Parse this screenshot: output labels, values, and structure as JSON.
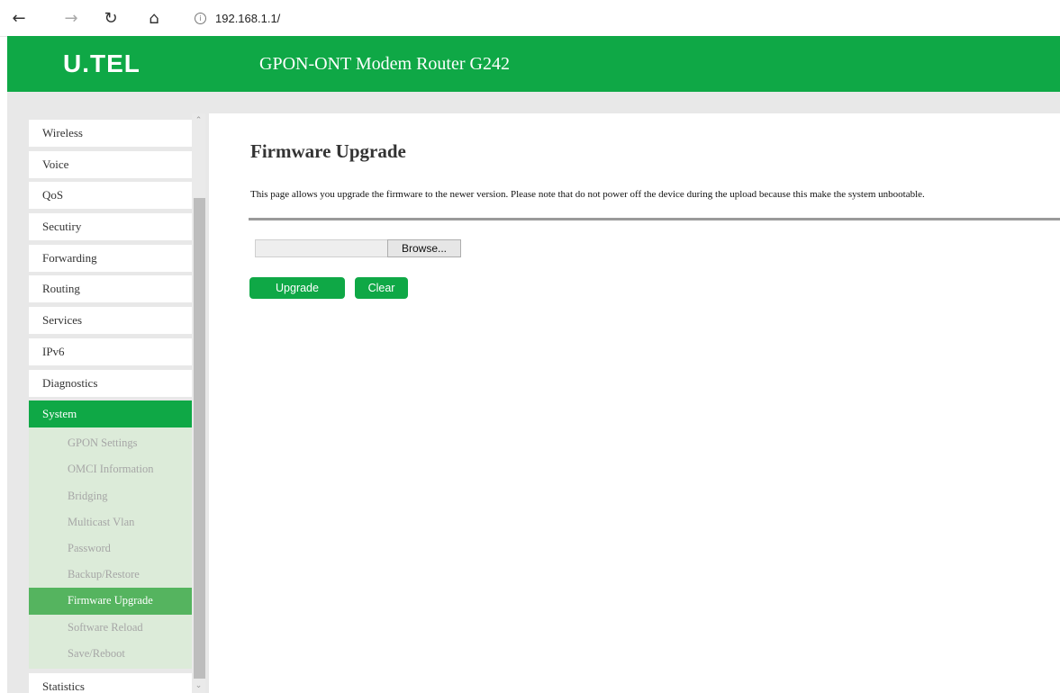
{
  "browser": {
    "url": "192.168.1.1/",
    "back_icon": "arrow-left-icon",
    "forward_icon": "arrow-right-icon",
    "refresh_icon": "refresh-icon",
    "home_icon": "home-icon"
  },
  "header": {
    "logo_text": "U.TEL",
    "title": "GPON-ONT Modem Router G242"
  },
  "colors": {
    "brand_green": "#0fa846",
    "submenu_bg": "#dcebd9",
    "submenu_active": "#55b45f"
  },
  "sidebar": {
    "items": [
      {
        "label": "Wireless"
      },
      {
        "label": "Voice"
      },
      {
        "label": "QoS"
      },
      {
        "label": "Secutiry"
      },
      {
        "label": "Forwarding"
      },
      {
        "label": "Routing"
      },
      {
        "label": "Services"
      },
      {
        "label": "IPv6"
      },
      {
        "label": "Diagnostics"
      },
      {
        "label": "System"
      },
      {
        "label": "Statistics"
      }
    ],
    "system_submenu": [
      {
        "label": "GPON Settings"
      },
      {
        "label": "OMCI Information"
      },
      {
        "label": "Bridging"
      },
      {
        "label": "Multicast Vlan"
      },
      {
        "label": "Password"
      },
      {
        "label": "Backup/Restore"
      },
      {
        "label": "Firmware Upgrade"
      },
      {
        "label": "Software Reload"
      },
      {
        "label": "Save/Reboot"
      }
    ],
    "active_item": "System",
    "active_subitem": "Firmware Upgrade"
  },
  "main": {
    "title": "Firmware Upgrade",
    "description": "This page allows you upgrade the firmware to the newer version. Please note that do not power off the device during the upload because this make the system unbootable.",
    "file_input": {
      "value": "",
      "browse_label": "Browse..."
    },
    "upgrade_label": "Upgrade",
    "clear_label": "Clear"
  }
}
